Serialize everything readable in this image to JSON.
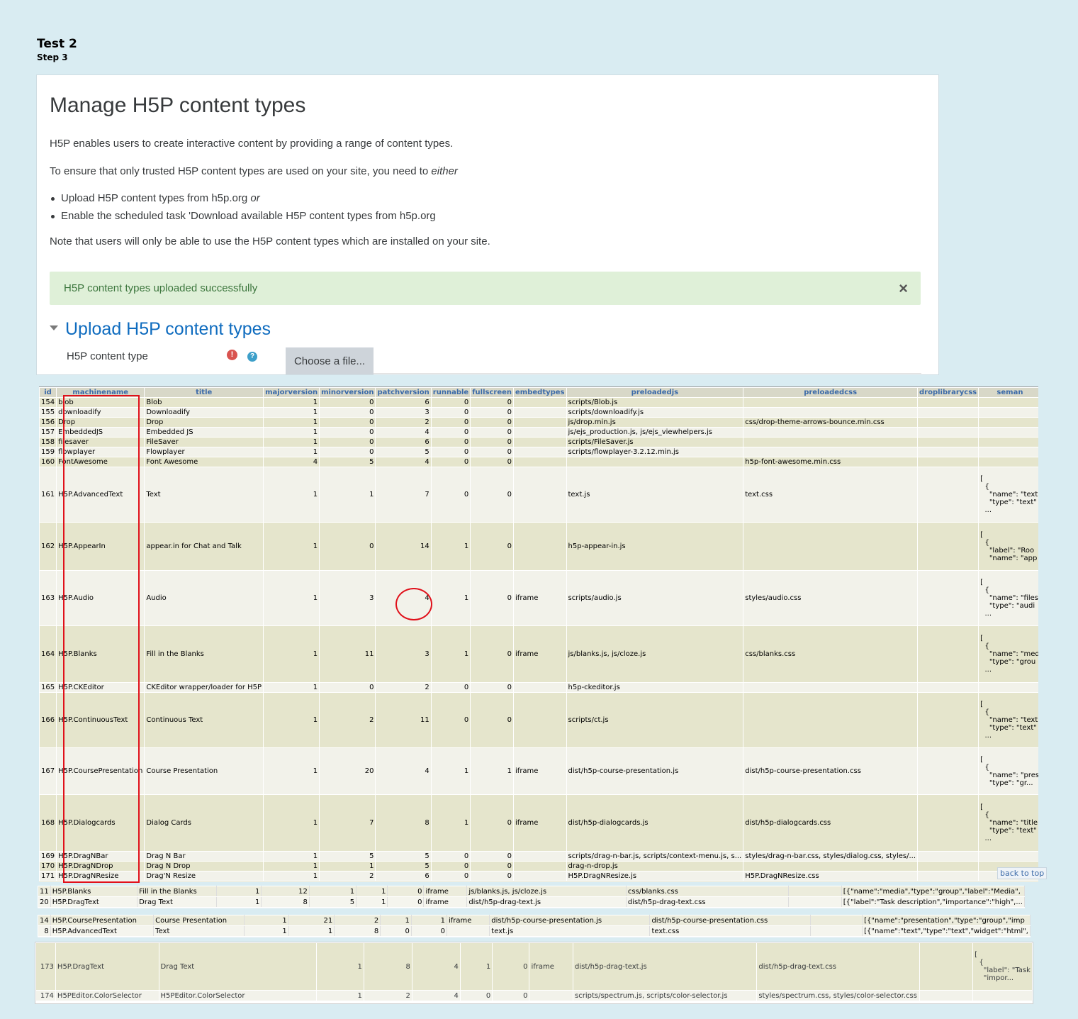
{
  "doc": {
    "title": "Test 2",
    "step": "Step 3"
  },
  "page": {
    "title": "Manage H5P content types",
    "intro": "H5P enables users to create interactive content by providing a range of content types.",
    "ensure_prefix": "To ensure that only trusted H5P content types are used on your site, you need to ",
    "ensure_em": "either",
    "bullet1_prefix": "Upload H5P content types from h5p.org ",
    "bullet1_em": "or",
    "bullet2": "Enable the scheduled task 'Download available H5P content types from h5p.org",
    "note": "Note that users will only be able to use the H5P content types which are installed on your site.",
    "alert": "H5P content types uploaded successfully",
    "alert_close": "×",
    "section": "Upload H5P content types",
    "field_label": "H5P content type",
    "choose": "Choose a file..."
  },
  "db": {
    "columns": [
      "id",
      "machinename",
      "title",
      "majorversion",
      "minorversion",
      "patchversion",
      "runnable",
      "fullscreen",
      "embedtypes",
      "preloadedjs",
      "preloadedcss",
      "droplibrarycss",
      "seman"
    ],
    "rows": [
      [
        "154",
        "blob",
        "Blob",
        "1",
        "0",
        "6",
        "0",
        "0",
        "",
        "scripts/Blob.js",
        "",
        "",
        ""
      ],
      [
        "155",
        "downloadify",
        "Downloadify",
        "1",
        "0",
        "3",
        "0",
        "0",
        "",
        "scripts/downloadify.js",
        "",
        "",
        ""
      ],
      [
        "156",
        "Drop",
        "Drop",
        "1",
        "0",
        "2",
        "0",
        "0",
        "",
        "js/drop.min.js",
        "css/drop-theme-arrows-bounce.min.css",
        "",
        ""
      ],
      [
        "157",
        "EmbeddedJS",
        "Embedded JS",
        "1",
        "0",
        "4",
        "0",
        "0",
        "",
        "js/ejs_production.js, js/ejs_viewhelpers.js",
        "",
        "",
        ""
      ],
      [
        "158",
        "filesaver",
        "FileSaver",
        "1",
        "0",
        "6",
        "0",
        "0",
        "",
        "scripts/FileSaver.js",
        "",
        "",
        ""
      ],
      [
        "159",
        "flowplayer",
        "Flowplayer",
        "1",
        "0",
        "5",
        "0",
        "0",
        "",
        "scripts/flowplayer-3.2.12.min.js",
        "",
        "",
        ""
      ],
      [
        "160",
        "FontAwesome",
        "Font Awesome",
        "4",
        "5",
        "4",
        "0",
        "0",
        "",
        "",
        "h5p-font-awesome.min.css",
        "",
        ""
      ],
      [
        "161",
        "H5P.AdvancedText",
        "Text",
        "1",
        "1",
        "7",
        "0",
        "0",
        "",
        "text.js",
        "text.css",
        "",
        "[\n  {\n    \"name\": \"text\n    \"type\": \"text\"\n  ..."
      ],
      [
        "162",
        "H5P.AppearIn",
        "appear.in for Chat and Talk",
        "1",
        "0",
        "14",
        "1",
        "0",
        "",
        "h5p-appear-in.js",
        "",
        "",
        "[\n  {\n    \"label\": \"Roo\n    \"name\": \"app"
      ],
      [
        "163",
        "H5P.Audio",
        "Audio",
        "1",
        "3",
        "4",
        "1",
        "0",
        "iframe",
        "scripts/audio.js",
        "styles/audio.css",
        "",
        "[\n  {\n    \"name\": \"files\n    \"type\": \"audi\n  ..."
      ],
      [
        "164",
        "H5P.Blanks",
        "Fill in the Blanks",
        "1",
        "11",
        "3",
        "1",
        "0",
        "iframe",
        "js/blanks.js, js/cloze.js",
        "css/blanks.css",
        "",
        "[\n  {\n    \"name\": \"med\n    \"type\": \"grou\n  ..."
      ],
      [
        "165",
        "H5P.CKEditor",
        "CKEditor wrapper/loader for H5P",
        "1",
        "0",
        "2",
        "0",
        "0",
        "",
        "h5p-ckeditor.js",
        "",
        "",
        ""
      ],
      [
        "166",
        "H5P.ContinuousText",
        "Continuous Text",
        "1",
        "2",
        "11",
        "0",
        "0",
        "",
        "scripts/ct.js",
        "",
        "",
        "[\n  {\n    \"name\": \"text\n    \"type\": \"text\"\n  ..."
      ],
      [
        "167",
        "H5P.CoursePresentation",
        "Course Presentation",
        "1",
        "20",
        "4",
        "1",
        "1",
        "iframe",
        "dist/h5p-course-presentation.js",
        "dist/h5p-course-presentation.css",
        "",
        "[\n  {\n    \"name\": \"pres\n    \"type\": \"gr..."
      ],
      [
        "168",
        "H5P.Dialogcards",
        "Dialog Cards",
        "1",
        "7",
        "8",
        "1",
        "0",
        "iframe",
        "dist/h5p-dialogcards.js",
        "dist/h5p-dialogcards.css",
        "",
        "[\n  {\n    \"name\": \"title\n    \"type\": \"text\"\n  ..."
      ],
      [
        "169",
        "H5P.DragNBar",
        "Drag N Bar",
        "1",
        "5",
        "5",
        "0",
        "0",
        "",
        "scripts/drag-n-bar.js, scripts/context-menu.js, s...",
        "styles/drag-n-bar.css, styles/dialog.css, styles/...",
        "",
        ""
      ],
      [
        "170",
        "H5P.DragNDrop",
        "Drag N Drop",
        "1",
        "1",
        "5",
        "0",
        "0",
        "",
        "drag-n-drop.js",
        "",
        "",
        ""
      ],
      [
        "171",
        "H5P.DragNResize",
        "Drag'N Resize",
        "1",
        "2",
        "6",
        "0",
        "0",
        "",
        "H5P.DragNResize.js",
        "H5P.DragNResize.css",
        "",
        ""
      ]
    ],
    "back_to_top": "back to top"
  },
  "strip1": [
    [
      "11",
      "H5P.Blanks",
      "Fill in the Blanks",
      "1",
      "12",
      "1",
      "1",
      "0",
      "iframe",
      "js/blanks.js, js/cloze.js",
      "css/blanks.css",
      "",
      "[{\"name\":\"media\",\"type\":\"group\",\"label\":\"Media\","
    ],
    [
      "20",
      "H5P.DragText",
      "Drag Text",
      "1",
      "8",
      "5",
      "1",
      "0",
      "iframe",
      "dist/h5p-drag-text.js",
      "dist/h5p-drag-text.css",
      "",
      "[{\"label\":\"Task description\",\"importance\":\"high\",..."
    ]
  ],
  "strip2": [
    [
      "14",
      "H5P.CoursePresentation",
      "Course Presentation",
      "1",
      "21",
      "2",
      "1",
      "1",
      "iframe",
      "dist/h5p-course-presentation.js",
      "dist/h5p-course-presentation.css",
      "",
      "[{\"name\":\"presentation\",\"type\":\"group\",\"imp"
    ],
    [
      "8",
      "H5P.AdvancedText",
      "Text",
      "1",
      "1",
      "8",
      "0",
      "0",
      "",
      "text.js",
      "text.css",
      "",
      "[{\"name\":\"text\",\"type\":\"text\",\"widget\":\"html\","
    ]
  ],
  "strip3": [
    [
      "173",
      "H5P.DragText",
      "Drag Text",
      "1",
      "8",
      "4",
      "1",
      "0",
      "iframe",
      "dist/h5p-drag-text.js",
      "dist/h5p-drag-text.css",
      "",
      "[\n  {\n    \"label\": \"Task\n    \"impor..."
    ],
    [
      "174",
      "H5PEditor.ColorSelector",
      "H5PEditor.ColorSelector",
      "1",
      "2",
      "4",
      "0",
      "0",
      "",
      "scripts/spectrum.js, scripts/color-selector.js",
      "styles/spectrum.css, styles/color-selector.css",
      "",
      ""
    ]
  ]
}
